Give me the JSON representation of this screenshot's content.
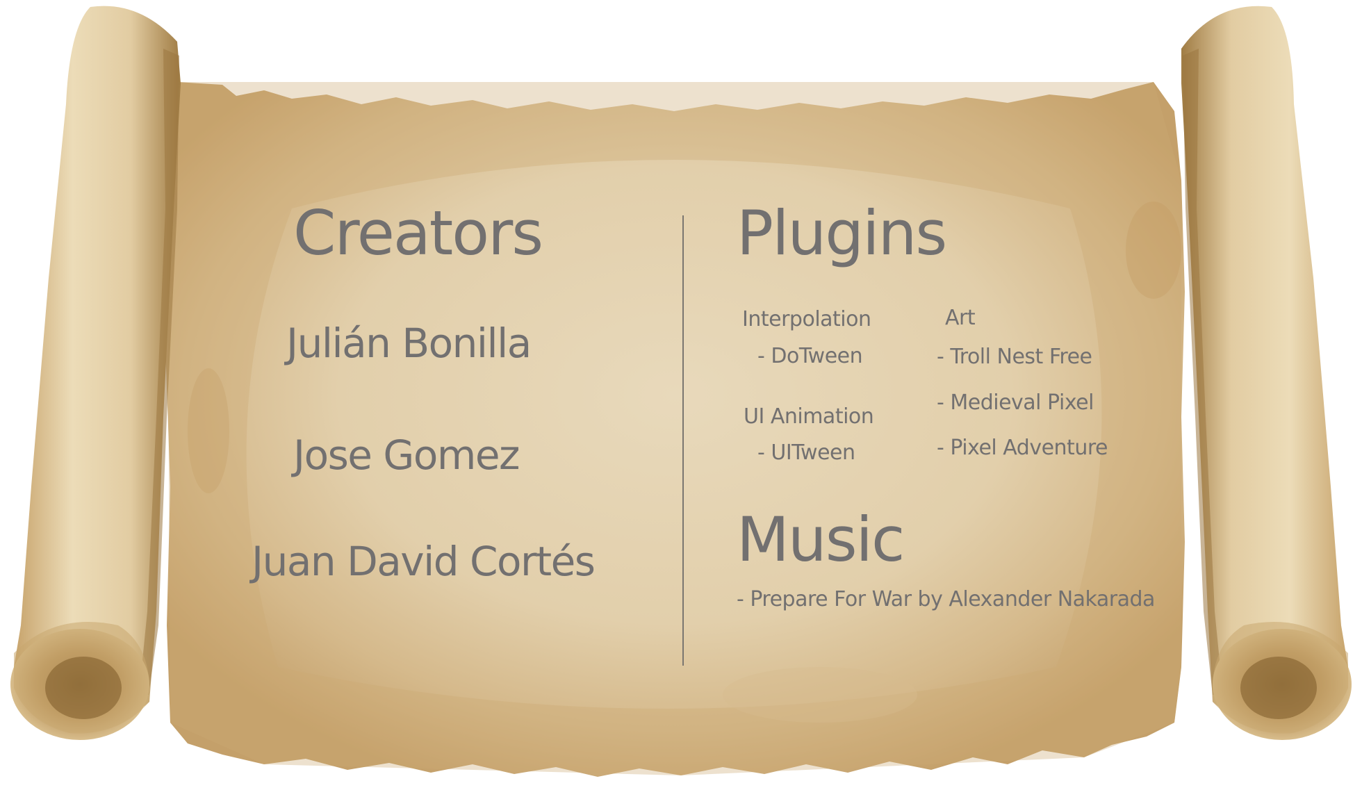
{
  "colors": {
    "text": "#727070",
    "parchment_light": "#e6d6b6",
    "parchment_mid": "#d9bf92",
    "parchment_dark": "#b08a4f",
    "roll_shadow": "#7a5a2a"
  },
  "creators": {
    "title": "Creators",
    "names": [
      "Julián Bonilla",
      "Jose Gomez",
      "Juan David Cortés"
    ]
  },
  "plugins": {
    "title": "Plugins",
    "interpolation": {
      "label": "Interpolation",
      "items": [
        "- DoTween"
      ]
    },
    "ui_animation": {
      "label": "UI Animation",
      "items": [
        "- UITween"
      ]
    },
    "art": {
      "label": "Art",
      "items": [
        "- Troll Nest Free",
        "- Medieval Pixel",
        "- Pixel Adventure"
      ]
    }
  },
  "music": {
    "title": "Music",
    "tracks": [
      "- Prepare For War by Alexander Nakarada"
    ]
  }
}
